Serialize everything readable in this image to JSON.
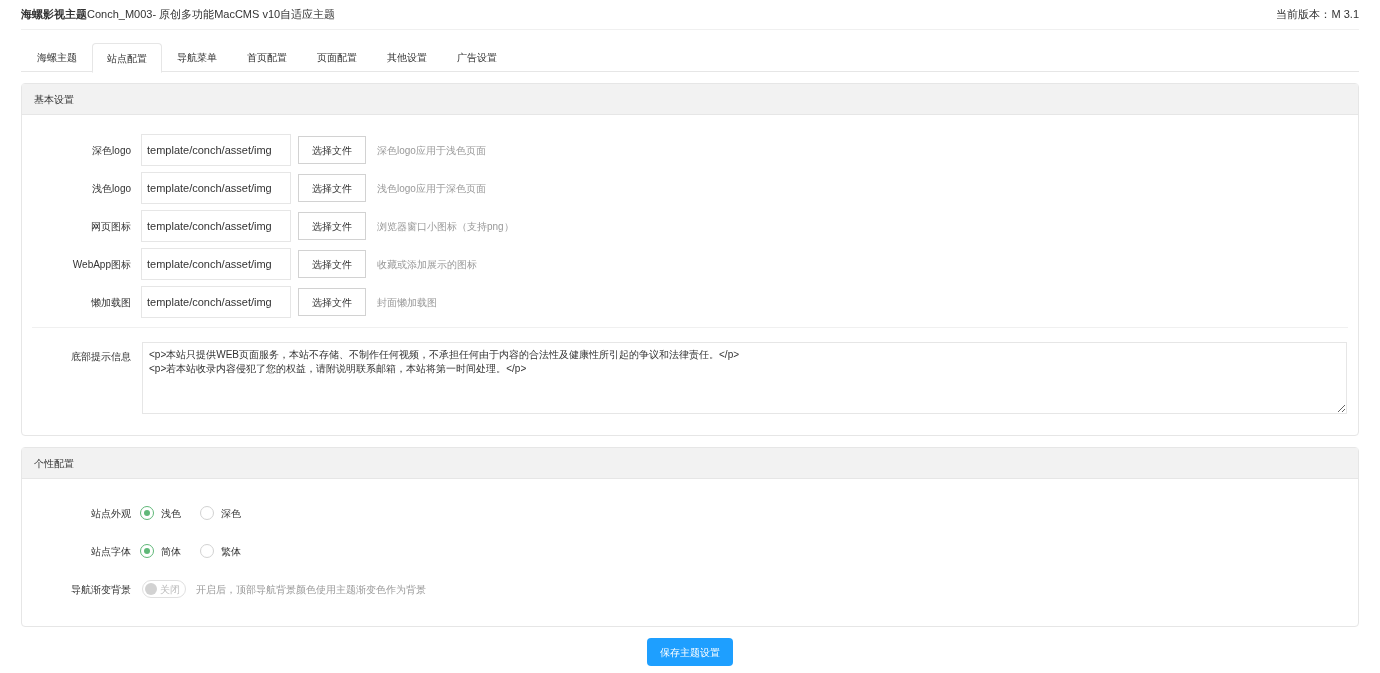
{
  "header": {
    "title_bold": "海螺影视主题",
    "title_rest": "Conch_M003- 原创多功能MacCMS v10自适应主题",
    "version": "当前版本：M 3.1"
  },
  "tabs": [
    {
      "label": "海螺主题",
      "selected": false
    },
    {
      "label": "站点配置",
      "selected": true
    },
    {
      "label": "导航菜单",
      "selected": false
    },
    {
      "label": "首页配置",
      "selected": false
    },
    {
      "label": "页面配置",
      "selected": false
    },
    {
      "label": "其他设置",
      "selected": false
    },
    {
      "label": "广告设置",
      "selected": false
    }
  ],
  "basic_panel": {
    "title": "基本设置",
    "file_rows": [
      {
        "label": "深色logo",
        "value": "template/conch/asset/img",
        "button": "选择文件",
        "hint": "深色logo应用于浅色页面"
      },
      {
        "label": "浅色logo",
        "value": "template/conch/asset/img",
        "button": "选择文件",
        "hint": "浅色logo应用于深色页面"
      },
      {
        "label": "网页图标",
        "value": "template/conch/asset/img",
        "button": "选择文件",
        "hint": "浏览器窗口小图标（支持png）"
      },
      {
        "label": "WebApp图标",
        "value": "template/conch/asset/img",
        "button": "选择文件",
        "hint": "收藏或添加展示的图标"
      },
      {
        "label": "懒加载图",
        "value": "template/conch/asset/img",
        "button": "选择文件",
        "hint": "封面懒加载图"
      }
    ],
    "footer_info": {
      "label": "底部提示信息",
      "value": "<p>本站只提供WEB页面服务，本站不存储、不制作任何视频，不承担任何由于内容的合法性及健康性所引起的争议和法律责任。</p>\n<p>若本站收录内容侵犯了您的权益，请附说明联系邮箱，本站将第一时间处理。</p>"
    }
  },
  "custom_panel": {
    "title": "个性配置",
    "rows": [
      {
        "kind": "radio",
        "label": "站点外观",
        "options": [
          {
            "label": "浅色",
            "selected": true
          },
          {
            "label": "深色",
            "selected": false
          }
        ]
      },
      {
        "kind": "radio",
        "label": "站点字体",
        "options": [
          {
            "label": "简体",
            "selected": true
          },
          {
            "label": "繁体",
            "selected": false
          }
        ]
      },
      {
        "kind": "switch",
        "label": "导航渐变背景",
        "on": false,
        "switch_text": "关闭",
        "hint": "开启后，顶部导航背景颜色使用主题渐变色作为背景"
      }
    ]
  },
  "save_button": "保存主题设置"
}
